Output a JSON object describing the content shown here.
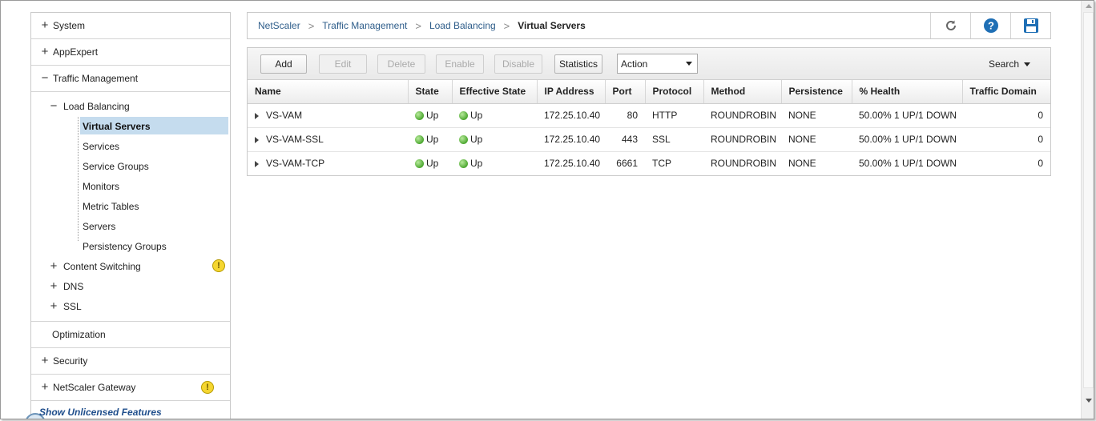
{
  "sidebar": {
    "sections_top": [
      {
        "label": "System",
        "toggle": "+"
      },
      {
        "label": "AppExpert",
        "toggle": "+"
      },
      {
        "label": "Traffic Management",
        "toggle": "−"
      }
    ],
    "tree": {
      "load_balancing": {
        "label": "Load Balancing",
        "toggle": "−"
      },
      "leaves": [
        {
          "label": "Virtual Servers",
          "selected": true
        },
        {
          "label": "Services"
        },
        {
          "label": "Service Groups"
        },
        {
          "label": "Monitors"
        },
        {
          "label": "Metric Tables"
        },
        {
          "label": "Servers"
        },
        {
          "label": "Persistency Groups"
        }
      ],
      "collapsed": [
        {
          "label": "Content Switching",
          "toggle": "+",
          "warning": "!"
        },
        {
          "label": "DNS",
          "toggle": "+"
        },
        {
          "label": "SSL",
          "toggle": "+"
        }
      ]
    },
    "sections_bottom": [
      {
        "label": "Optimization"
      },
      {
        "label": "Security",
        "toggle": "+"
      },
      {
        "label": "NetScaler Gateway",
        "toggle": "+",
        "warning": "!"
      }
    ],
    "unlicensed_link": "Show Unlicensed Features"
  },
  "breadcrumb": {
    "items": [
      "NetScaler",
      "Traffic Management",
      "Load Balancing"
    ],
    "current": "Virtual Servers",
    "separator": ">"
  },
  "header_tools": {
    "refresh_icon": "refresh-icon",
    "help_icon": "help-icon",
    "save_icon": "save-icon",
    "accent": "#1f6fb5"
  },
  "toolbar": {
    "add": "Add",
    "edit": "Edit",
    "delete": "Delete",
    "enable": "Enable",
    "disable": "Disable",
    "statistics": "Statistics",
    "action": "Action",
    "search": "Search"
  },
  "table": {
    "columns": [
      "Name",
      "State",
      "Effective State",
      "IP Address",
      "Port",
      "Protocol",
      "Method",
      "Persistence",
      "% Health",
      "Traffic Domain"
    ],
    "rows": [
      {
        "name": "VS-VAM",
        "state": "Up",
        "effective_state": "Up",
        "ip": "172.25.10.40",
        "port": "80",
        "protocol": "HTTP",
        "method": "ROUNDROBIN",
        "persistence": "NONE",
        "health": "50.00% 1 UP/1 DOWN",
        "traffic_domain": "0"
      },
      {
        "name": "VS-VAM-SSL",
        "state": "Up",
        "effective_state": "Up",
        "ip": "172.25.10.40",
        "port": "443",
        "protocol": "SSL",
        "method": "ROUNDROBIN",
        "persistence": "NONE",
        "health": "50.00% 1 UP/1 DOWN",
        "traffic_domain": "0"
      },
      {
        "name": "VS-VAM-TCP",
        "state": "Up",
        "effective_state": "Up",
        "ip": "172.25.10.40",
        "port": "6661",
        "protocol": "TCP",
        "method": "ROUNDROBIN",
        "persistence": "NONE",
        "health": "50.00% 1 UP/1 DOWN",
        "traffic_domain": "0"
      }
    ],
    "status_color": "#4ea832"
  }
}
